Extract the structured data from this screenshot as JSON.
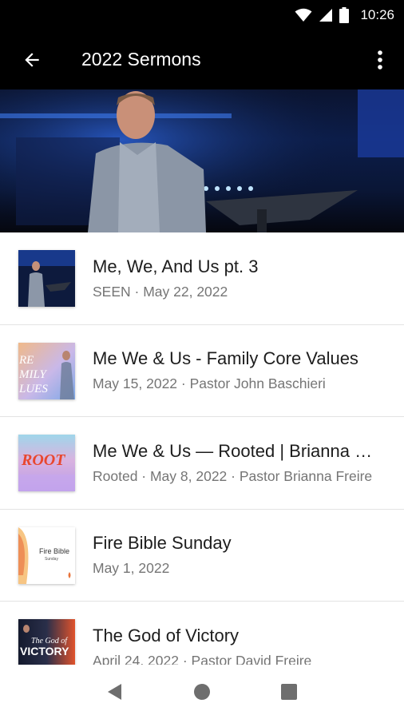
{
  "status_bar": {
    "time": "10:26"
  },
  "app_bar": {
    "title": "2022 Sermons"
  },
  "sermons": [
    {
      "title": "Me, We, And Us pt. 3",
      "subtitle": "SEEN · May 22, 2022"
    },
    {
      "title": "Me We & Us - Family Core Values",
      "subtitle": "May 15, 2022 · Pastor John Baschieri"
    },
    {
      "title": "Me We & Us — Rooted |  Brianna Freire",
      "subtitle": "Rooted · May 8, 2022 · Pastor Brianna Freire"
    },
    {
      "title": "Fire Bible Sunday",
      "subtitle": "May 1, 2022"
    },
    {
      "title": "The God of Victory",
      "subtitle": "April 24, 2022 · Pastor David Freire"
    }
  ],
  "thumbnails": {
    "family": "RE MILY LUES",
    "rooted": "ROOT",
    "fire": "Fire Bible",
    "fire_small": "Sunday",
    "victory_script": "The God of",
    "victory": "VICTORY"
  }
}
